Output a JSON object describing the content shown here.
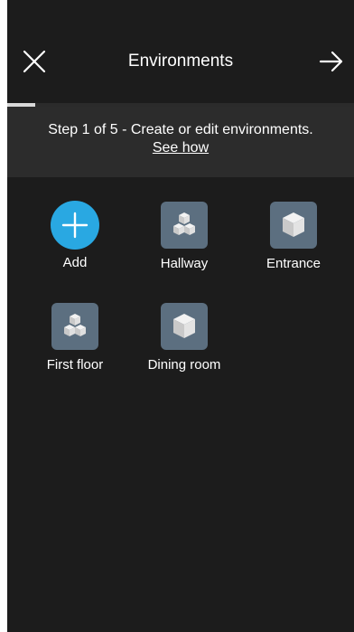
{
  "header": {
    "title": "Environments",
    "close_icon": "close-icon",
    "next_icon": "arrow-right-icon"
  },
  "progress": {
    "step": 1,
    "total": 5,
    "fraction": 0.2
  },
  "banner": {
    "text": "Step 1 of 5 - Create or edit environments.",
    "link": "See how"
  },
  "environments": [
    {
      "label": "Add",
      "icon": "add-icon"
    },
    {
      "label": "Hallway",
      "icon": "multi-cube-icon"
    },
    {
      "label": "Entrance",
      "icon": "cube-icon"
    },
    {
      "label": "First floor",
      "icon": "multi-cube-icon"
    },
    {
      "label": "Dining room",
      "icon": "cube-icon"
    }
  ],
  "colors": {
    "background": "#1c1c1c",
    "banner": "#2c2c2c",
    "accent": "#29a8e2",
    "room_tile": "#5c6f80",
    "text": "#ffffff"
  }
}
